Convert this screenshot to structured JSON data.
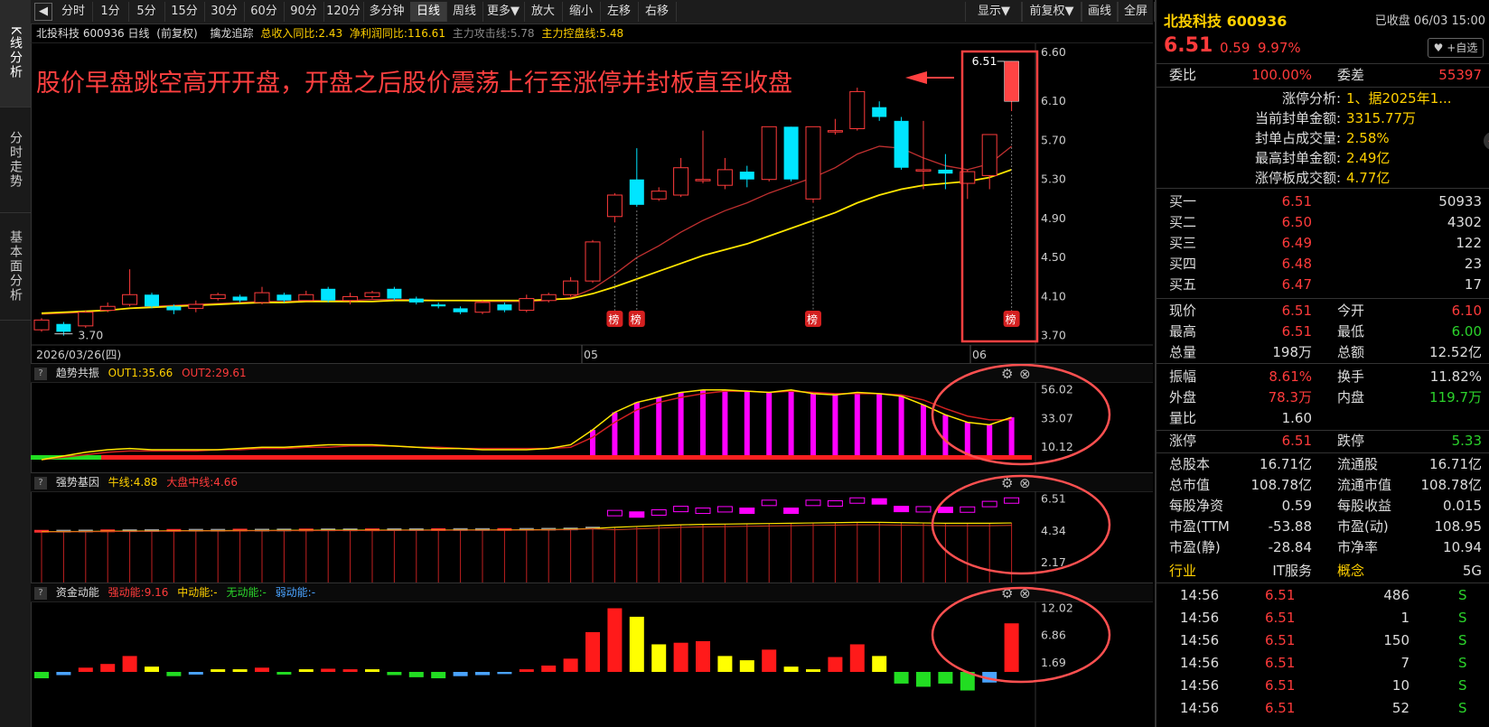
{
  "left_tabs": [
    "K线分析",
    "分时走势",
    "基本面分析"
  ],
  "toolbar": {
    "items": [
      "分时",
      "1分",
      "5分",
      "15分",
      "30分",
      "60分",
      "90分",
      "120分",
      "多分钟",
      "日线",
      "周线",
      "更多▼",
      "放大",
      "缩小",
      "左移",
      "右移"
    ],
    "right_items": [
      "显示▼",
      "前复权▼",
      "画线",
      "全屏"
    ],
    "active": "日线"
  },
  "info_line": {
    "stock": "北投科技 600936 日线",
    "adj": "(前复权)",
    "indicator": "擒龙追踪",
    "rev_growth": "总收入同比:2.43",
    "profit_growth": "净利润同比:116.61",
    "attack_line": "主力攻击线:5.78",
    "control_line": "主力控盘线:5.48"
  },
  "annotation": "股价早盘跳空高开开盘，开盘之后股价震荡上行至涨停并封板直至收盘",
  "main_chart": {
    "y_ticks": [
      "6.60",
      "6.10",
      "5.70",
      "5.30",
      "4.90",
      "4.50",
      "4.10",
      "3.70"
    ],
    "x_labels": [
      "2026/03/26(四)",
      "05",
      "06"
    ],
    "low_label": "3.70",
    "high_label": "6.51",
    "badge": "榜"
  },
  "sub1": {
    "title": "趋势共振",
    "out1": "OUT1:35.66",
    "out2": "OUT2:29.61",
    "y_ticks": [
      "56.02",
      "33.07",
      "10.12"
    ]
  },
  "sub2": {
    "title": "强势基因",
    "l1": "牛线:4.88",
    "l2": "大盘中线:4.66",
    "y_ticks": [
      "6.51",
      "4.34",
      "2.17"
    ]
  },
  "sub3": {
    "title": "资金动能",
    "strong": "强动能:9.16",
    "mid": "中动能:-",
    "none": "无动能:-",
    "weak": "弱动能:-",
    "y_ticks": [
      "12.02",
      "6.86",
      "1.69"
    ]
  },
  "right": {
    "name": "北投科技 600936",
    "status": "已收盘 06/03 15:00",
    "price": "6.51",
    "change": "0.59",
    "pct": "9.97%",
    "watch": "+自选",
    "wb_label": "委比",
    "wb_val": "100.00%",
    "wc_label": "委差",
    "wc_val": "55397",
    "limit_info": [
      {
        "k": "涨停分析:",
        "v": "1、据2025年1..."
      },
      {
        "k": "当前封单金额:",
        "v": "3315.77万"
      },
      {
        "k": "封单占成交量:",
        "v": "2.58%"
      },
      {
        "k": "最高封单金额:",
        "v": "2.49亿"
      },
      {
        "k": "涨停板成交额:",
        "v": "4.77亿"
      }
    ],
    "bids": [
      {
        "k": "买一",
        "p": "6.51",
        "v": "50933"
      },
      {
        "k": "买二",
        "p": "6.50",
        "v": "4302"
      },
      {
        "k": "买三",
        "p": "6.49",
        "v": "122"
      },
      {
        "k": "买四",
        "p": "6.48",
        "v": "23"
      },
      {
        "k": "买五",
        "p": "6.47",
        "v": "17"
      }
    ],
    "stats": [
      {
        "k1": "现价",
        "v1": "6.51",
        "k2": "今开",
        "v2": "6.10"
      },
      {
        "k1": "最高",
        "v1": "6.51",
        "k2": "最低",
        "v2": "6.00"
      },
      {
        "k1": "总量",
        "v1": "198万",
        "k2": "总额",
        "v2": "12.52亿"
      }
    ],
    "stats2": [
      {
        "k1": "振幅",
        "v1": "8.61%",
        "k2": "换手",
        "v2": "11.82%"
      },
      {
        "k1": "外盘",
        "v1": "78.3万",
        "k2": "内盘",
        "v2": "119.7万"
      },
      {
        "k1": "量比",
        "v1": "1.60",
        "k2": "",
        "v2": ""
      }
    ],
    "limits": {
      "k1": "涨停",
      "v1": "6.51",
      "k2": "跌停",
      "v2": "5.33"
    },
    "fund": [
      {
        "k1": "总股本",
        "v1": "16.71亿",
        "k2": "流通股",
        "v2": "16.71亿"
      },
      {
        "k1": "总市值",
        "v1": "108.78亿",
        "k2": "流通市值",
        "v2": "108.78亿"
      },
      {
        "k1": "每股净资",
        "v1": "0.59",
        "k2": "每股收益",
        "v2": "0.015"
      },
      {
        "k1": "市盈(TTM",
        "v1": "-53.88",
        "k2": "市盈(动)",
        "v2": "108.95"
      },
      {
        "k1": "市盈(静)",
        "v1": "-28.84",
        "k2": "市净率",
        "v2": "10.94"
      }
    ],
    "industry": {
      "k1": "行业",
      "v1": "IT服务",
      "k2": "概念",
      "v2": "5G"
    },
    "ticks": [
      {
        "t": "14:56",
        "p": "6.51",
        "v": "486",
        "s": "S"
      },
      {
        "t": "14:56",
        "p": "6.51",
        "v": "1",
        "s": "S"
      },
      {
        "t": "14:56",
        "p": "6.51",
        "v": "150",
        "s": "S"
      },
      {
        "t": "14:56",
        "p": "6.51",
        "v": "7",
        "s": "S"
      },
      {
        "t": "14:56",
        "p": "6.51",
        "v": "10",
        "s": "S"
      },
      {
        "t": "14:56",
        "p": "6.51",
        "v": "52",
        "s": "S"
      }
    ]
  },
  "colors": {
    "up": "#ff3b3b",
    "down": "#00e5ff",
    "ma_yellow": "#ffe600",
    "ma_red": "#d83030",
    "magenta": "#ff00ff",
    "green": "#22dd22"
  }
}
